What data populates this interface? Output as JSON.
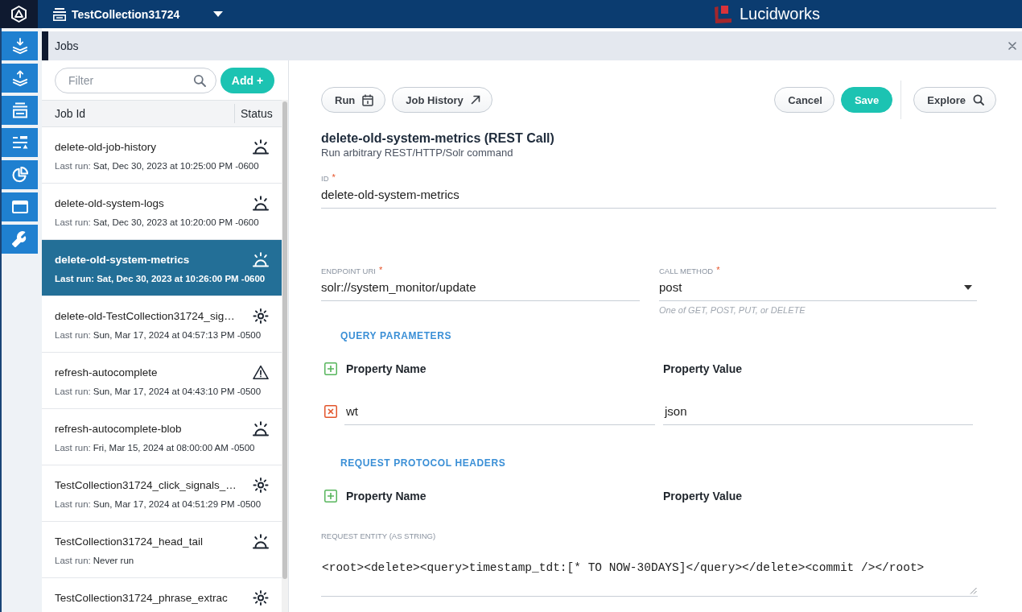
{
  "top_bar": {
    "collection": "TestCollection31724",
    "brand": "Lucidworks"
  },
  "panel": {
    "title": "Jobs"
  },
  "job_list": {
    "filter": {
      "placeholder": "Filter"
    },
    "add_button": "Add +",
    "columns": [
      "Job Id",
      "Status"
    ],
    "rows": [
      {
        "name": "delete-old-job-history",
        "last_run_label": "Last run:",
        "last_run": "Sat, Dec 30, 2023 at 10:25:00 PM -0600",
        "status": {
          "kind": "sunrise"
        },
        "selected": false
      },
      {
        "name": "delete-old-system-logs",
        "last_run_label": "Last run:",
        "last_run": "Sat, Dec 30, 2023 at 10:20:00 PM -0600",
        "status": {
          "kind": "sunrise"
        },
        "selected": false
      },
      {
        "name": "delete-old-system-metrics",
        "last_run_label": "Last run:",
        "last_run": "Sat, Dec 30, 2023 at 10:26:00 PM -0600",
        "status": {
          "kind": "sunrise"
        },
        "selected": true
      },
      {
        "name": "delete-old-TestCollection31724_sig…",
        "last_run_label": "Last run:",
        "last_run": "Sun, Mar 17, 2024 at 04:57:13 PM -0500",
        "status": {
          "kind": "sun"
        },
        "selected": false
      },
      {
        "name": "refresh-autocomplete",
        "last_run_label": "Last run:",
        "last_run": "Sun, Mar 17, 2024 at 04:43:10 PM -0500",
        "status": {
          "kind": "warning"
        },
        "selected": false
      },
      {
        "name": "refresh-autocomplete-blob",
        "last_run_label": "Last run:",
        "last_run": "Fri, Mar 15, 2024 at 08:00:00 AM -0500",
        "status": {
          "kind": "sunrise"
        },
        "selected": false
      },
      {
        "name": "TestCollection31724_click_signals_…",
        "last_run_label": "Last run:",
        "last_run": "Sun, Mar 17, 2024 at 04:51:29 PM -0500",
        "status": {
          "kind": "sun"
        },
        "selected": false
      },
      {
        "name": "TestCollection31724_head_tail",
        "last_run_label": "Last run:",
        "last_run": "Never run",
        "status": {
          "kind": "sunrise"
        },
        "selected": false
      },
      {
        "name": "TestCollection31724_phrase_extrac",
        "status": {
          "kind": "sun"
        },
        "selected": false
      }
    ]
  },
  "editor": {
    "toolbar": {
      "left": [
        {
          "label": "Run",
          "kind": "calendar"
        },
        {
          "label": "Job History",
          "kind": "external"
        }
      ],
      "right": [
        {
          "label": "Cancel",
          "kind": "plain"
        },
        {
          "label": "Save",
          "kind": "primary"
        }
      ],
      "end": [
        {
          "label": "Explore",
          "kind": "search"
        }
      ]
    },
    "title": "delete-old-system-metrics (REST Call)",
    "subtitle": "Run arbitrary REST/HTTP/Solr command",
    "id_field": {
      "label": "ID",
      "required_mark": "*",
      "value": "delete-old-system-metrics"
    },
    "endpoint_field": {
      "label": "ENDPOINT URI",
      "required_mark": "*",
      "value": "solr://system_monitor/update"
    },
    "call_method_field": {
      "label": "CALL METHOD",
      "required_mark": "*",
      "value": "post",
      "hint": "One of GET, POST, PUT, or DELETE"
    },
    "query_parameters": {
      "title": "QUERY PARAMETERS",
      "columns": [
        "Property Name",
        "Property Value"
      ],
      "rows": [
        {
          "name": "wt",
          "value": "json"
        }
      ]
    },
    "request_headers": {
      "title": "REQUEST PROTOCOL HEADERS",
      "columns": [
        "Property Name",
        "Property Value"
      ]
    },
    "request_entity": {
      "label": "REQUEST ENTITY (AS STRING)",
      "value": "<root><delete><query>timestamp_tdt:[* TO NOW-30DAYS]</query></delete><commit /></root>"
    }
  }
}
